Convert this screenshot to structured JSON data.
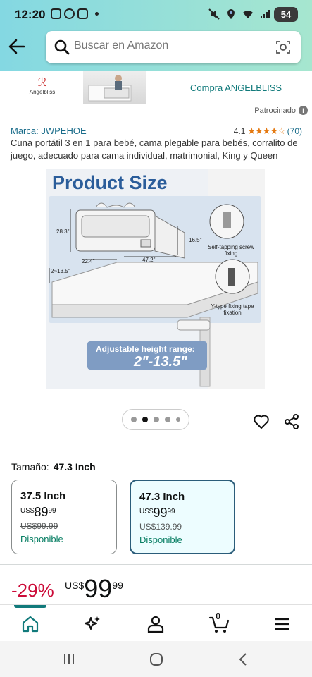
{
  "status_bar": {
    "time": "12:20",
    "battery": "54"
  },
  "search": {
    "placeholder": "Buscar en Amazon"
  },
  "banner": {
    "brand_logo_text": "Angelbliss",
    "link_text": "Compra ANGELBLISS"
  },
  "sponsored_label": "Patrocinado",
  "product": {
    "brand_text": "Marca: JWPEHOE",
    "rating_value": "4.1",
    "rating_stars": "★★★★☆",
    "rating_count": "(70)",
    "title": "Cuna portátil 3 en 1 para bebé, cama plegable para bebés, corralito de juego, adecuado para cama individual, matrimonial, King y Queen",
    "image": {
      "heading": "Product Size",
      "dim_28": "28.3\"",
      "dim_16": "16.5\"",
      "dim_22": "22.4\"",
      "dim_47": "47.2\"",
      "dim_2_13": "2~13.5\"",
      "screw_label": "Self-tapping screw fixing",
      "tape_label": "Y-type fixing tape fixation",
      "height_caption": "Adjustable height range:",
      "height_value": "2\"-13.5\""
    },
    "carousel": {
      "count": 5,
      "active_index": 1
    }
  },
  "size": {
    "label": "Tamaño:",
    "selected": "47.3 Inch",
    "options": [
      {
        "name": "37.5 Inch",
        "currency": "US$",
        "price_int": "89",
        "price_cents": "99",
        "old_price": "US$99.99",
        "availability": "Disponible",
        "selected": false
      },
      {
        "name": "47.3 Inch",
        "currency": "US$",
        "price_int": "99",
        "price_cents": "99",
        "old_price": "US$139.99",
        "availability": "Disponible",
        "selected": true
      }
    ]
  },
  "price": {
    "discount": "-29%",
    "currency": "US$",
    "int": "99",
    "cents": "99"
  },
  "bottom_nav": {
    "cart_count": "0",
    "active_tab": "home"
  },
  "colors": {
    "accent": "#117a7b",
    "discount": "#cc0c39",
    "star": "#e47911",
    "link": "#1a6c8a"
  }
}
